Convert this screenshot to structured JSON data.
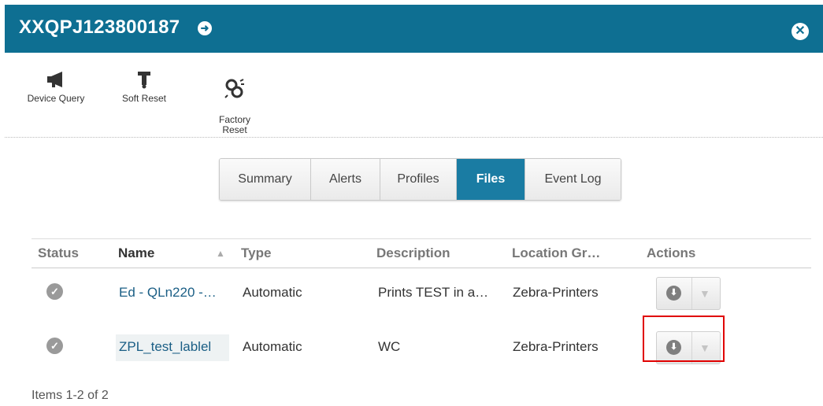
{
  "dialog": {
    "title": "XXQPJ123800187"
  },
  "toolbar": {
    "items": [
      {
        "label": "Device Query",
        "icon": "megaphone-icon"
      },
      {
        "label": "Soft Reset",
        "icon": "reset-icon"
      },
      {
        "label": "Factory\nReset",
        "icon": "factory-reset-icon"
      }
    ]
  },
  "tabs": [
    {
      "label": "Summary",
      "active": false
    },
    {
      "label": "Alerts",
      "active": false
    },
    {
      "label": "Profiles",
      "active": false
    },
    {
      "label": "Files",
      "active": true
    },
    {
      "label": "Event Log",
      "active": false
    }
  ],
  "table": {
    "columns": [
      "Status",
      "Name",
      "Type",
      "Description",
      "Location Gr…",
      "Actions"
    ],
    "sorted_column": "Name",
    "sort_direction": "ascending",
    "rows": [
      {
        "status": "check-icon",
        "name": "Ed - QLn220 -…",
        "type": "Automatic",
        "description": "Prints TEST in a…",
        "location": "Zebra-Printers"
      },
      {
        "status": "check-icon",
        "name": "ZPL_test_lablel",
        "type": "Automatic",
        "description": "WC",
        "location": "Zebra-Printers"
      }
    ]
  },
  "pager": {
    "text": "Items 1-2 of 2"
  },
  "colors": {
    "header": "#0e6f92",
    "active_tab": "#1a7ca3",
    "highlight": "#e00000"
  }
}
